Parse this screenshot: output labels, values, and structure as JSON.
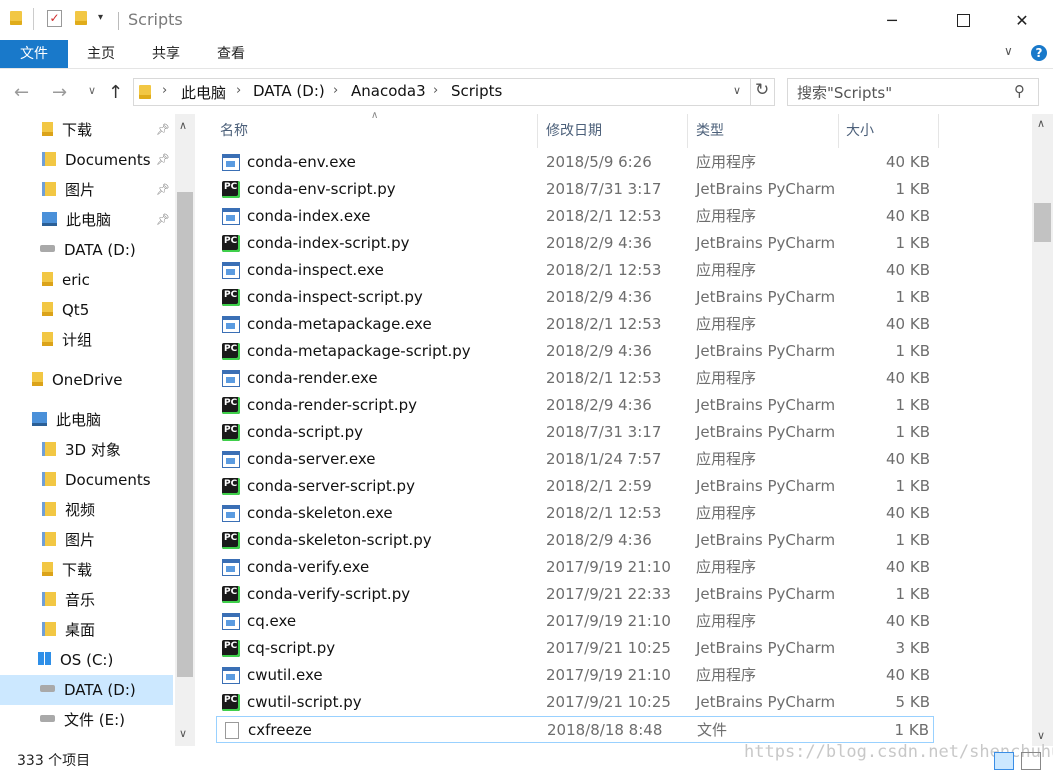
{
  "window": {
    "title": "Scripts",
    "controls": [
      "minimize",
      "maximize",
      "close"
    ]
  },
  "ribbon": {
    "tabs": [
      "文件",
      "主页",
      "共享",
      "查看"
    ]
  },
  "address": {
    "crumbs": [
      "此电脑",
      "DATA (D:)",
      "Anacoda3",
      "Scripts"
    ],
    "search_placeholder": "搜索\"Scripts\""
  },
  "sidebar": {
    "items": [
      {
        "label": "下载",
        "icon": "download-folder-icon",
        "pinned": true
      },
      {
        "label": "Documents",
        "icon": "documents-folder-icon",
        "pinned": true
      },
      {
        "label": "图片",
        "icon": "pictures-folder-icon",
        "pinned": true
      },
      {
        "label": "此电脑",
        "icon": "computer-icon",
        "pinned": true
      },
      {
        "label": "DATA (D:)",
        "icon": "drive-icon"
      },
      {
        "label": "eric",
        "icon": "folder-icon"
      },
      {
        "label": "Qt5",
        "icon": "folder-icon"
      },
      {
        "label": "计组",
        "icon": "folder-icon"
      },
      {
        "label": "OneDrive",
        "icon": "folder-icon"
      },
      {
        "label": "此电脑",
        "icon": "computer-icon"
      },
      {
        "label": "3D 对象",
        "icon": "3d-objects-folder-icon"
      },
      {
        "label": "Documents",
        "icon": "documents-folder-icon"
      },
      {
        "label": "视频",
        "icon": "videos-folder-icon"
      },
      {
        "label": "图片",
        "icon": "pictures-folder-icon"
      },
      {
        "label": "下载",
        "icon": "download-folder-icon"
      },
      {
        "label": "音乐",
        "icon": "music-folder-icon"
      },
      {
        "label": "桌面",
        "icon": "desktop-folder-icon"
      },
      {
        "label": "OS (C:)",
        "icon": "windows-drive-icon"
      },
      {
        "label": "DATA (D:)",
        "icon": "drive-icon",
        "selected": true
      },
      {
        "label": "文件 (E:)",
        "icon": "drive-icon"
      }
    ]
  },
  "columns": [
    "名称",
    "修改日期",
    "类型",
    "大小"
  ],
  "files": [
    {
      "name": "conda-env.exe",
      "date": "2018/5/9 6:26",
      "type": "应用程序",
      "size": "40 KB",
      "kind": "exe"
    },
    {
      "name": "conda-env-script.py",
      "date": "2018/7/31 3:17",
      "type": "JetBrains PyCharm",
      "size": "1 KB",
      "kind": "py"
    },
    {
      "name": "conda-index.exe",
      "date": "2018/2/1 12:53",
      "type": "应用程序",
      "size": "40 KB",
      "kind": "exe"
    },
    {
      "name": "conda-index-script.py",
      "date": "2018/2/9 4:36",
      "type": "JetBrains PyCharm",
      "size": "1 KB",
      "kind": "py"
    },
    {
      "name": "conda-inspect.exe",
      "date": "2018/2/1 12:53",
      "type": "应用程序",
      "size": "40 KB",
      "kind": "exe"
    },
    {
      "name": "conda-inspect-script.py",
      "date": "2018/2/9 4:36",
      "type": "JetBrains PyCharm",
      "size": "1 KB",
      "kind": "py"
    },
    {
      "name": "conda-metapackage.exe",
      "date": "2018/2/1 12:53",
      "type": "应用程序",
      "size": "40 KB",
      "kind": "exe"
    },
    {
      "name": "conda-metapackage-script.py",
      "date": "2018/2/9 4:36",
      "type": "JetBrains PyCharm",
      "size": "1 KB",
      "kind": "py"
    },
    {
      "name": "conda-render.exe",
      "date": "2018/2/1 12:53",
      "type": "应用程序",
      "size": "40 KB",
      "kind": "exe"
    },
    {
      "name": "conda-render-script.py",
      "date": "2018/2/9 4:36",
      "type": "JetBrains PyCharm",
      "size": "1 KB",
      "kind": "py"
    },
    {
      "name": "conda-script.py",
      "date": "2018/7/31 3:17",
      "type": "JetBrains PyCharm",
      "size": "1 KB",
      "kind": "py"
    },
    {
      "name": "conda-server.exe",
      "date": "2018/1/24 7:57",
      "type": "应用程序",
      "size": "40 KB",
      "kind": "exe"
    },
    {
      "name": "conda-server-script.py",
      "date": "2018/2/1 2:59",
      "type": "JetBrains PyCharm",
      "size": "1 KB",
      "kind": "py"
    },
    {
      "name": "conda-skeleton.exe",
      "date": "2018/2/1 12:53",
      "type": "应用程序",
      "size": "40 KB",
      "kind": "exe"
    },
    {
      "name": "conda-skeleton-script.py",
      "date": "2018/2/9 4:36",
      "type": "JetBrains PyCharm",
      "size": "1 KB",
      "kind": "py"
    },
    {
      "name": "conda-verify.exe",
      "date": "2017/9/19 21:10",
      "type": "应用程序",
      "size": "40 KB",
      "kind": "exe"
    },
    {
      "name": "conda-verify-script.py",
      "date": "2017/9/21 22:33",
      "type": "JetBrains PyCharm",
      "size": "1 KB",
      "kind": "py"
    },
    {
      "name": "cq.exe",
      "date": "2017/9/19 21:10",
      "type": "应用程序",
      "size": "40 KB",
      "kind": "exe"
    },
    {
      "name": "cq-script.py",
      "date": "2017/9/21 10:25",
      "type": "JetBrains PyCharm",
      "size": "3 KB",
      "kind": "py"
    },
    {
      "name": "cwutil.exe",
      "date": "2017/9/19 21:10",
      "type": "应用程序",
      "size": "40 KB",
      "kind": "exe"
    },
    {
      "name": "cwutil-script.py",
      "date": "2017/9/21 10:25",
      "type": "JetBrains PyCharm",
      "size": "5 KB",
      "kind": "py"
    },
    {
      "name": "cxfreeze",
      "date": "2018/8/18 8:48",
      "type": "文件",
      "size": "1 KB",
      "kind": "file",
      "focused": true
    }
  ],
  "status": {
    "item_count": "333 个项目"
  },
  "watermark": "https://blog.csdn.net/shenchuhu",
  "colors": {
    "accent": "#1979ca",
    "selected_bg": "#cce8ff",
    "focus_border": "#99d1ff",
    "header_text": "#4c607a"
  }
}
